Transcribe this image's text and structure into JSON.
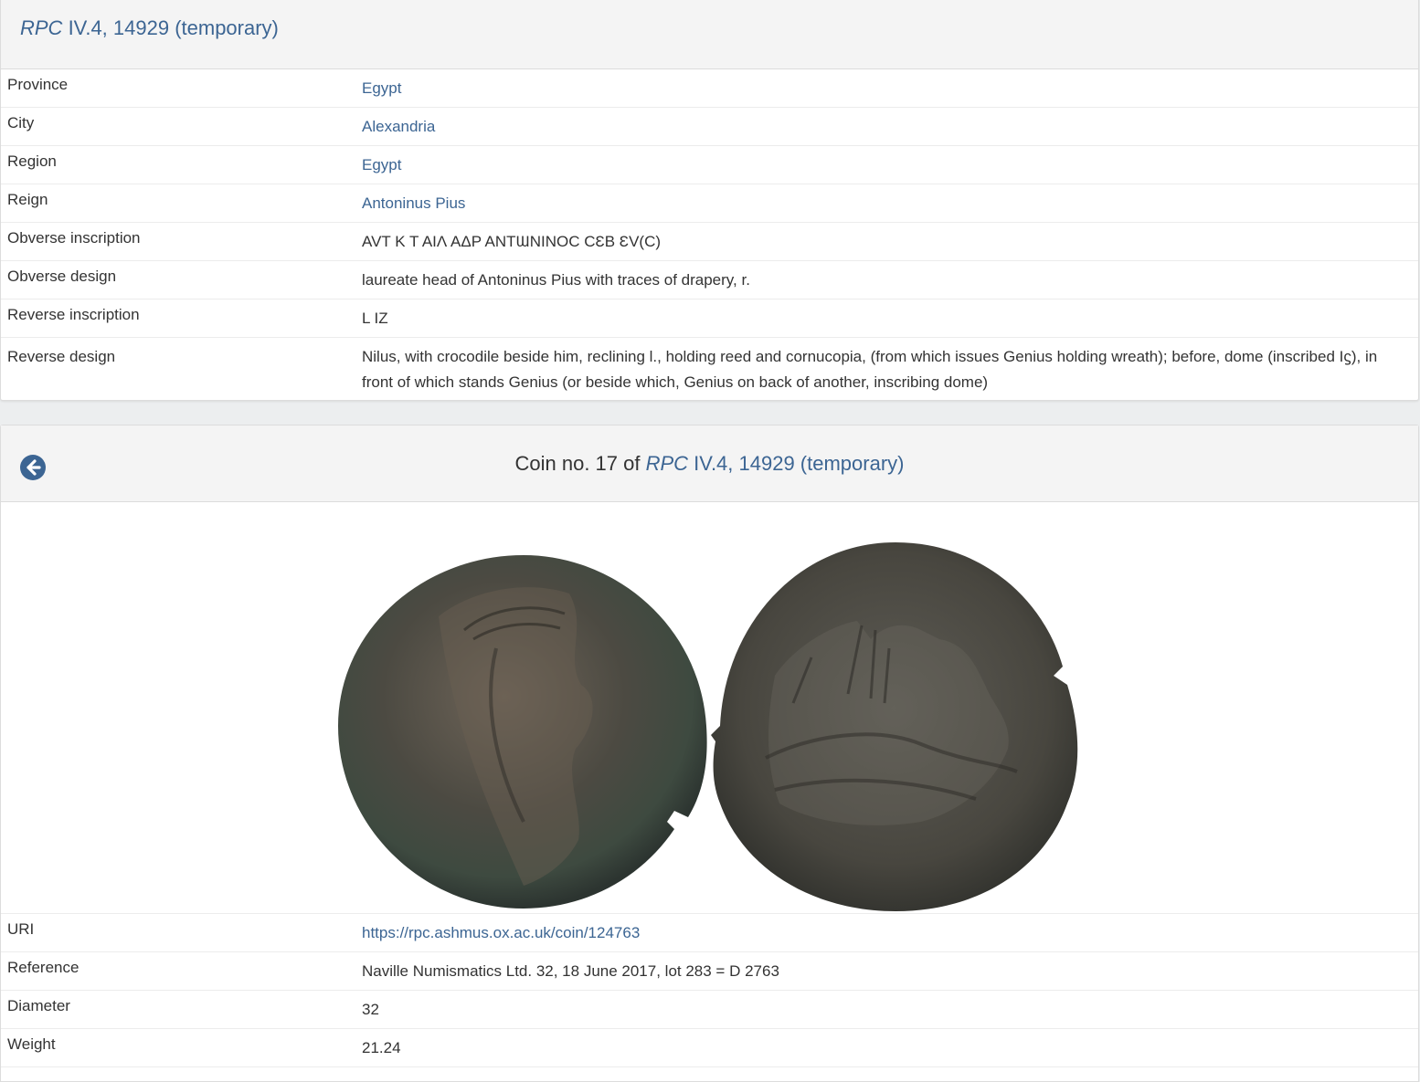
{
  "type_panel": {
    "title_italic": "RPC",
    "title_rest": " IV.4, 14929 (temporary)",
    "rows": [
      {
        "label": "Province",
        "value": "Egypt",
        "link": true
      },
      {
        "label": "City",
        "value": "Alexandria",
        "link": true
      },
      {
        "label": "Region",
        "value": "Egypt",
        "link": true
      },
      {
        "label": "Reign",
        "value": "Antoninus Pius",
        "link": true
      },
      {
        "label": "Obverse inscription",
        "value": "AVT K T AIΛ AΔP ANTƜNINOC CƐB ƐV(C)",
        "link": false
      },
      {
        "label": "Obverse design",
        "value": "laureate head of Antoninus Pius with traces of drapery, r.",
        "link": false
      },
      {
        "label": "Reverse inscription",
        "value": "L IZ",
        "link": false
      },
      {
        "label": "Reverse design",
        "value": "Nilus, with crocodile beside him, reclining l., holding reed and cornucopia, (from which issues Genius holding wreath); before, dome (inscribed Iϛ), in front of which stands Genius (or beside which, Genius on back of another, inscribing dome)",
        "link": false
      }
    ]
  },
  "coin_panel": {
    "title_prefix": "Coin no. 17 of ",
    "title_italic": "RPC",
    "title_rest": " IV.4, 14929 (temporary)",
    "back_icon": "arrow-circle-left-icon",
    "image_alt": "coin obverse and reverse",
    "rows": [
      {
        "label": "URI",
        "value": "https://rpc.ashmus.ox.ac.uk/coin/124763",
        "link": true
      },
      {
        "label": "Reference",
        "value": "Naville Numismatics Ltd. 32, 18 June 2017, lot 283 = D 2763",
        "link": false
      },
      {
        "label": "Diameter",
        "value": "32",
        "link": false
      },
      {
        "label": "Weight",
        "value": "21.24",
        "link": false
      }
    ]
  },
  "colors": {
    "link": "#3c6593",
    "text": "#333333",
    "heading_bg": "#f4f4f4",
    "page_bg": "#eceeef"
  }
}
